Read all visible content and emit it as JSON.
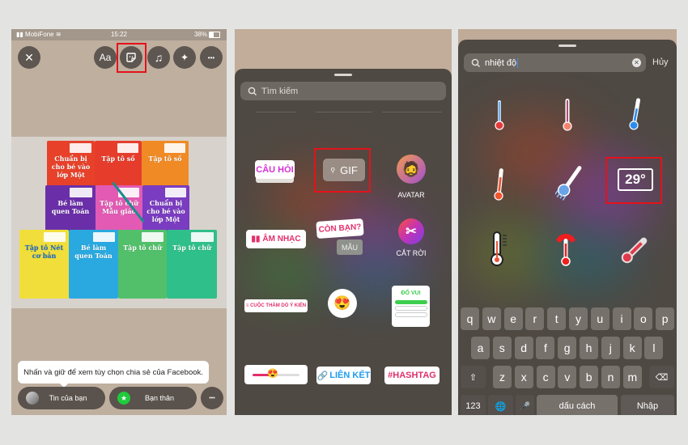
{
  "panel1": {
    "status": {
      "carrier": "MobiFone",
      "time": "15:22",
      "battery": "38%"
    },
    "toolbar": {
      "close_icon": "✕",
      "text_label": "Aa",
      "sticker_icon": "sticker",
      "music_icon": "♫",
      "effects_icon": "✦",
      "more_icon": "•••"
    },
    "books": [
      {
        "title": "Chuẩn bị cho bé vào lớp Một",
        "color": "#e8412a"
      },
      {
        "title": "Tập tô số",
        "color": "#e63c2c"
      },
      {
        "title": "Tập tô số",
        "color": "#f08a25"
      },
      {
        "title": "Bé làm quen Toán",
        "color": "#6a2fa8"
      },
      {
        "title": "Tập tô chữ Mẫu giáo",
        "color": "#e25ab4"
      },
      {
        "title": "Chuẩn bị cho bé vào lớp Một",
        "color": "#7a3cc0"
      },
      {
        "title": "Tập tô Nét cơ bản",
        "color": "#f1de3a"
      },
      {
        "title": "Bé làm quen Toán",
        "color": "#29a9e0"
      },
      {
        "title": "Tập tô chữ",
        "color": "#52c06a"
      },
      {
        "title": "Tập tô chữ",
        "color": "#2fbf8a"
      }
    ],
    "tooltip": "Nhấn và giữ để xem tùy chọn chia sẻ của Facebook.",
    "share": {
      "your_story": "Tin của bạn",
      "close_friends": "Bạn thân",
      "more": "•••"
    }
  },
  "panel2": {
    "search_placeholder": "Tìm kiếm",
    "stickers": {
      "question": "CÂU HỎI",
      "gif": "GIF",
      "avatar": "AVATAR",
      "music": "ÂM NHẠC",
      "add_yours": "CÒN BẠN?",
      "template": "MẪU",
      "cutout": "CẮT RỜI",
      "poll": "≡ CUỘC THĂM DÒ Ý KIẾN",
      "emoji": "😍",
      "quiz": "ĐỐ VUI",
      "slider_emoji": "😍",
      "link": "LIÊN KẾT",
      "hashtag": "#HASHTAG"
    },
    "colors": {
      "pink": "#e1306c",
      "magenta": "#d62fd6",
      "blue": "#1f9bf0",
      "green": "#3ccf4e"
    }
  },
  "panel3": {
    "search_value": "nhiệt độ",
    "cancel_label": "Hủy",
    "results": [
      "thermometer-red-sticker",
      "thermometer-striped-sticker",
      "thermometer-blue-sticker",
      "thermometer-orange-sticker",
      "thermometer-frozen-sticker",
      "temperature-29c-sticker",
      "thermometer-outline-sticker",
      "thermometer-hot-sticker",
      "thermometer-tilted-sticker"
    ],
    "temperature_label": "29°",
    "keyboard": {
      "row1": [
        "q",
        "w",
        "e",
        "r",
        "t",
        "y",
        "u",
        "i",
        "o",
        "p"
      ],
      "row2": [
        "a",
        "s",
        "d",
        "f",
        "g",
        "h",
        "j",
        "k",
        "l"
      ],
      "row3": [
        "z",
        "x",
        "c",
        "v",
        "b",
        "n",
        "m"
      ],
      "shift": "⇧",
      "delete": "⌫",
      "numbers": "123",
      "globe": "🌐",
      "mic": "🎤",
      "space": "dấu cách",
      "return": "Nhập"
    }
  }
}
